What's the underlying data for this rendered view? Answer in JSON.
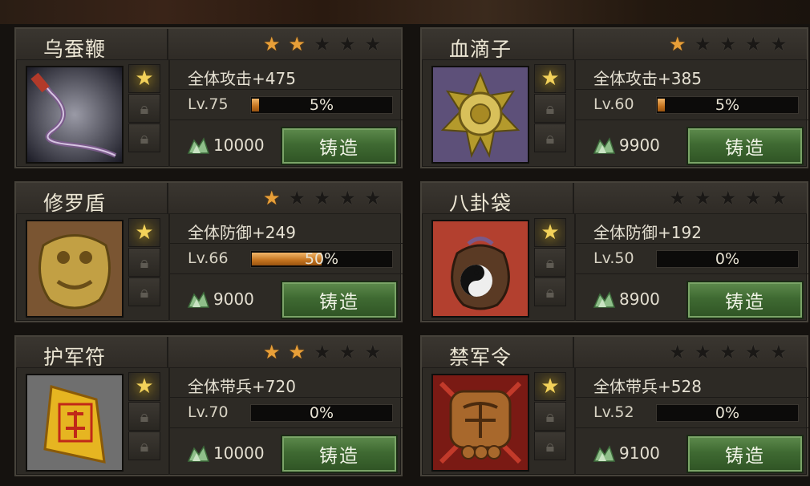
{
  "forge_label": "铸造",
  "items": [
    {
      "name": "乌蚕鞭",
      "stars": 2,
      "stat": "全体攻击+475",
      "level": "Lv.75",
      "progress": 0.05,
      "progress_text": "5%",
      "cost": "10000",
      "thumb": "whip"
    },
    {
      "name": "血滴子",
      "stars": 1,
      "stat": "全体攻击+385",
      "level": "Lv.60",
      "progress": 0.05,
      "progress_text": "5%",
      "cost": "9900",
      "thumb": "star-disc"
    },
    {
      "name": "修罗盾",
      "stars": 1,
      "stat": "全体防御+249",
      "level": "Lv.66",
      "progress": 0.5,
      "progress_text": "50%",
      "cost": "9000",
      "thumb": "shield"
    },
    {
      "name": "八卦袋",
      "stars": 0,
      "stat": "全体防御+192",
      "level": "Lv.50",
      "progress": 0,
      "progress_text": "0%",
      "cost": "8900",
      "thumb": "bagua-bag"
    },
    {
      "name": "护军符",
      "stars": 2,
      "stat": "全体带兵+720",
      "level": "Lv.70",
      "progress": 0,
      "progress_text": "0%",
      "cost": "10000",
      "thumb": "talisman"
    },
    {
      "name": "禁军令",
      "stars": 0,
      "stat": "全体带兵+528",
      "level": "Lv.52",
      "progress": 0,
      "progress_text": "0%",
      "cost": "9100",
      "thumb": "command-token"
    }
  ],
  "colors": {
    "star_on": "#e89f38",
    "star_off": "#1a1816",
    "button": "#3f6a32",
    "progress": "#c4731f"
  },
  "icons": {
    "slot_gem": "gem-icon",
    "slot_locked": "lock-icon",
    "cost": "silver-ingot-icon",
    "star": "star-icon"
  }
}
